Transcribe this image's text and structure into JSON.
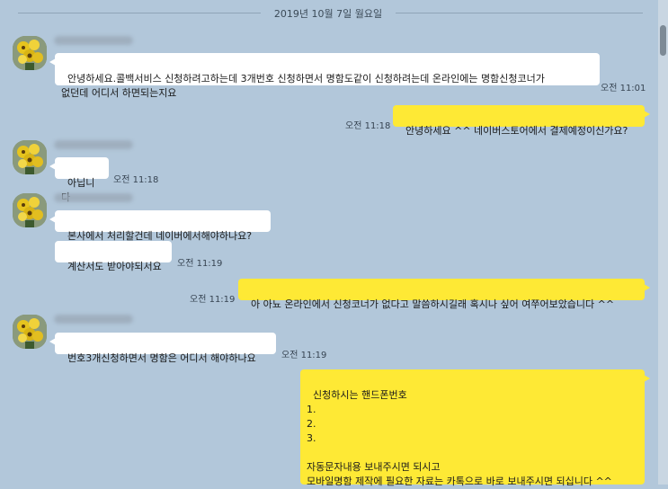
{
  "date_separator": "2019년 10월 7일 월요일",
  "messages": [
    {
      "id": "m1",
      "side": "left",
      "text": "안녕하세요.콜백서비스 신청하려고하는데 3개번호 신청하면서 명함도같이 신청하려는데 온라인에는 명함신청코너가\n없던데 어디서 하면되는지요",
      "time": "오전 11:01"
    },
    {
      "id": "m2",
      "side": "right",
      "text": "안녕하세요 ^^ 네이버스토어에서 결제예정이신가요?",
      "time": "오전 11:18"
    },
    {
      "id": "m3",
      "side": "left",
      "text": "아닙니다",
      "time": "오전 11:18"
    },
    {
      "id": "m4",
      "side": "left",
      "text": "본사에서 처리할건데 네이버에서해야하나요?",
      "time": ""
    },
    {
      "id": "m5",
      "side": "left",
      "text": "계산서도 받아야되서요",
      "time": "오전 11:19"
    },
    {
      "id": "m6",
      "side": "right",
      "text": "아 아뇨 온라인에서 신청코너가 없다고 말씀하시길래 혹시나 싶어 여쭈어보았습니다 ^^",
      "time": "오전 11:19"
    },
    {
      "id": "m7",
      "side": "left",
      "text": "번호3개신청하면서 명함은 어디서 해야하나요",
      "time": "오전 11:19"
    },
    {
      "id": "m8",
      "side": "right",
      "text": "신청하시는 핸드폰번호\n1.\n2.\n3.\n\n자동문자내용 보내주시면 되시고\n모바일명함 제작에 필요한 자료는 카톡으로 바로 보내주시면 되십니다 ^^",
      "time": ""
    }
  ]
}
